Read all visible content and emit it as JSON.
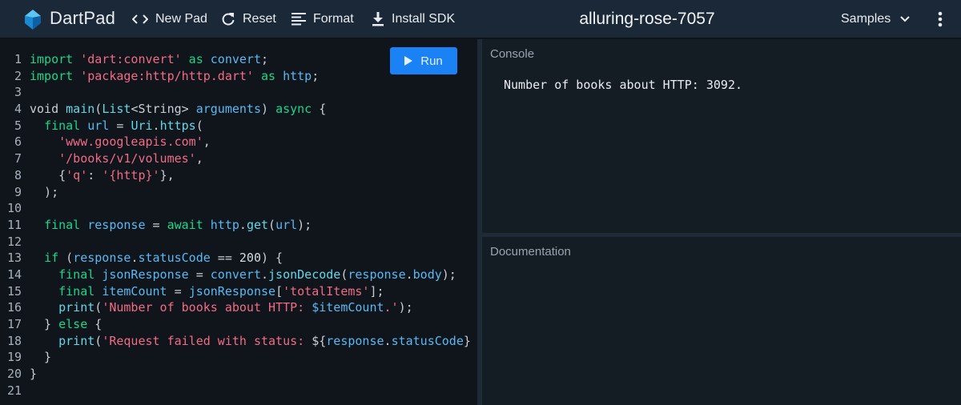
{
  "app": {
    "name": "DartPad"
  },
  "toolbar": {
    "new_pad": "New Pad",
    "reset": "Reset",
    "format": "Format",
    "install_sdk": "Install SDK",
    "pad_title": "alluring-rose-7057",
    "samples": "Samples"
  },
  "editor": {
    "run_label": "Run",
    "lines": [
      {
        "n": "1",
        "tokens": [
          [
            "import ",
            "k"
          ],
          [
            "'dart:convert'",
            "s"
          ],
          [
            " as ",
            "k"
          ],
          [
            "convert",
            "i"
          ],
          [
            ";",
            "p"
          ]
        ]
      },
      {
        "n": "2",
        "tokens": [
          [
            "import ",
            "k"
          ],
          [
            "'package:http/http.dart'",
            "s"
          ],
          [
            " as ",
            "k"
          ],
          [
            "http",
            "i"
          ],
          [
            ";",
            "p"
          ]
        ]
      },
      {
        "n": "3",
        "tokens": []
      },
      {
        "n": "4",
        "tokens": [
          [
            "void ",
            "p"
          ],
          [
            "main",
            "f"
          ],
          [
            "(",
            "p"
          ],
          [
            "List",
            "f"
          ],
          [
            "<String> ",
            "p"
          ],
          [
            "arguments",
            "i"
          ],
          [
            ") ",
            "p"
          ],
          [
            "async",
            "k"
          ],
          [
            " {",
            "p"
          ]
        ]
      },
      {
        "n": "5",
        "tokens": [
          [
            "  ",
            "p"
          ],
          [
            "final ",
            "k"
          ],
          [
            "url",
            "i"
          ],
          [
            " = ",
            "p"
          ],
          [
            "Uri",
            "f"
          ],
          [
            ".",
            "p"
          ],
          [
            "https",
            "f"
          ],
          [
            "(",
            "p"
          ]
        ]
      },
      {
        "n": "6",
        "tokens": [
          [
            "    ",
            "p"
          ],
          [
            "'www.googleapis.com'",
            "s"
          ],
          [
            ",",
            "p"
          ]
        ]
      },
      {
        "n": "7",
        "tokens": [
          [
            "    ",
            "p"
          ],
          [
            "'/books/v1/volumes'",
            "s"
          ],
          [
            ",",
            "p"
          ]
        ]
      },
      {
        "n": "8",
        "tokens": [
          [
            "    {",
            "p"
          ],
          [
            "'q'",
            "s"
          ],
          [
            ": ",
            "p"
          ],
          [
            "'{http}'",
            "s"
          ],
          [
            "},",
            "p"
          ]
        ]
      },
      {
        "n": "9",
        "tokens": [
          [
            "  );",
            "p"
          ]
        ]
      },
      {
        "n": "10",
        "tokens": []
      },
      {
        "n": "11",
        "tokens": [
          [
            "  ",
            "p"
          ],
          [
            "final ",
            "k"
          ],
          [
            "response",
            "i"
          ],
          [
            " = ",
            "p"
          ],
          [
            "await ",
            "k"
          ],
          [
            "http",
            "i"
          ],
          [
            ".",
            "p"
          ],
          [
            "get",
            "f"
          ],
          [
            "(",
            "p"
          ],
          [
            "url",
            "i"
          ],
          [
            ");",
            "p"
          ]
        ]
      },
      {
        "n": "12",
        "tokens": []
      },
      {
        "n": "13",
        "tokens": [
          [
            "  ",
            "p"
          ],
          [
            "if ",
            "k"
          ],
          [
            "(",
            "p"
          ],
          [
            "response",
            "i"
          ],
          [
            ".",
            "p"
          ],
          [
            "statusCode",
            "i"
          ],
          [
            " == ",
            "p"
          ],
          [
            "200",
            "n"
          ],
          [
            ") {",
            "p"
          ]
        ]
      },
      {
        "n": "14",
        "tokens": [
          [
            "    ",
            "p"
          ],
          [
            "final ",
            "k"
          ],
          [
            "jsonResponse",
            "i"
          ],
          [
            " = ",
            "p"
          ],
          [
            "convert",
            "i"
          ],
          [
            ".",
            "p"
          ],
          [
            "jsonDecode",
            "f"
          ],
          [
            "(",
            "p"
          ],
          [
            "response",
            "i"
          ],
          [
            ".",
            "p"
          ],
          [
            "body",
            "i"
          ],
          [
            ");",
            "p"
          ]
        ]
      },
      {
        "n": "15",
        "tokens": [
          [
            "    ",
            "p"
          ],
          [
            "final ",
            "k"
          ],
          [
            "itemCount",
            "i"
          ],
          [
            " = ",
            "p"
          ],
          [
            "jsonResponse",
            "i"
          ],
          [
            "[",
            "p"
          ],
          [
            "'totalItems'",
            "s"
          ],
          [
            "];",
            "p"
          ]
        ]
      },
      {
        "n": "16",
        "tokens": [
          [
            "    ",
            "p"
          ],
          [
            "print",
            "f"
          ],
          [
            "(",
            "p"
          ],
          [
            "'Number of books about HTTP: ",
            "s"
          ],
          [
            "$itemCount",
            "i"
          ],
          [
            ".'",
            "s"
          ],
          [
            ");",
            "p"
          ]
        ]
      },
      {
        "n": "17",
        "tokens": [
          [
            "  } ",
            "p"
          ],
          [
            "else",
            "k"
          ],
          [
            " {",
            "p"
          ]
        ]
      },
      {
        "n": "18",
        "tokens": [
          [
            "    ",
            "p"
          ],
          [
            "print",
            "f"
          ],
          [
            "(",
            "p"
          ],
          [
            "'Request failed with status: ",
            "s"
          ],
          [
            "${",
            "p"
          ],
          [
            "response",
            "i"
          ],
          [
            ".",
            "p"
          ],
          [
            "statusCode",
            "i"
          ],
          [
            "}",
            "p"
          ]
        ]
      },
      {
        "n": "19",
        "tokens": [
          [
            "  }",
            "p"
          ]
        ]
      },
      {
        "n": "20",
        "tokens": [
          [
            "}",
            "p"
          ]
        ]
      },
      {
        "n": "21",
        "tokens": []
      }
    ]
  },
  "console": {
    "title": "Console",
    "output": "Number of books about HTTP: 3092."
  },
  "documentation": {
    "title": "Documentation"
  },
  "colors": {
    "keyword": "#19d68b",
    "string": "#f26b86",
    "function": "#64d7e6",
    "identifier": "#5ab8f2",
    "run_button": "#1a82f5",
    "topbar": "#1b2838"
  },
  "icons": [
    "dart-logo-icon",
    "code-icon",
    "reset-icon",
    "format-icon",
    "download-icon",
    "chevron-down-icon",
    "more-vert-icon",
    "play-icon"
  ]
}
